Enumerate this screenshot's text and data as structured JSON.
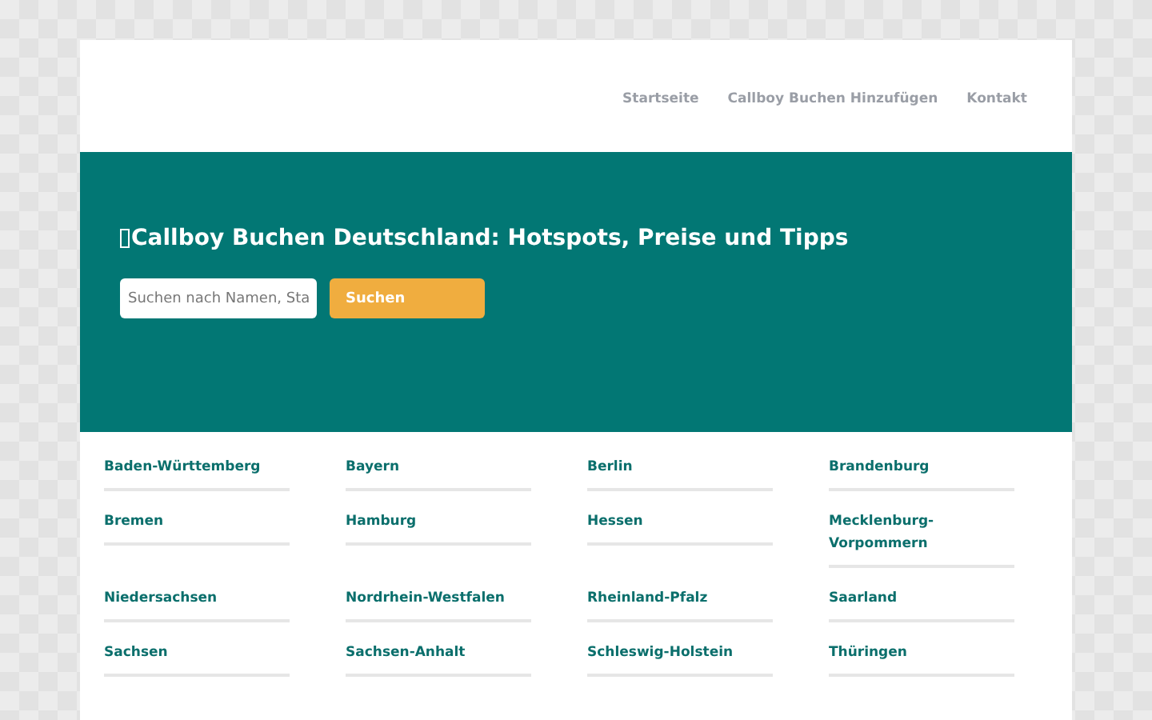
{
  "nav": {
    "items": [
      "Startseite",
      "Callboy Buchen Hinzufügen",
      "Kontakt"
    ]
  },
  "hero": {
    "title": "Callboy Buchen Deutschland: Hotspots, Preise und Tipps",
    "search": {
      "placeholder": "Suchen nach Namen, Sta"
    },
    "button": "Suchen"
  },
  "regions": [
    "Baden-Württemberg",
    "Bayern",
    "Berlin",
    "Brandenburg",
    "Bremen",
    "Hamburg",
    "Hessen",
    "Mecklenburg-Vorpommern",
    "Niedersachsen",
    "Nordrhein-Westfalen",
    "Rheinland-Pfalz",
    "Saarland",
    "Sachsen",
    "Sachsen-Anhalt",
    "Schleswig-Holstein",
    "Thüringen"
  ]
}
